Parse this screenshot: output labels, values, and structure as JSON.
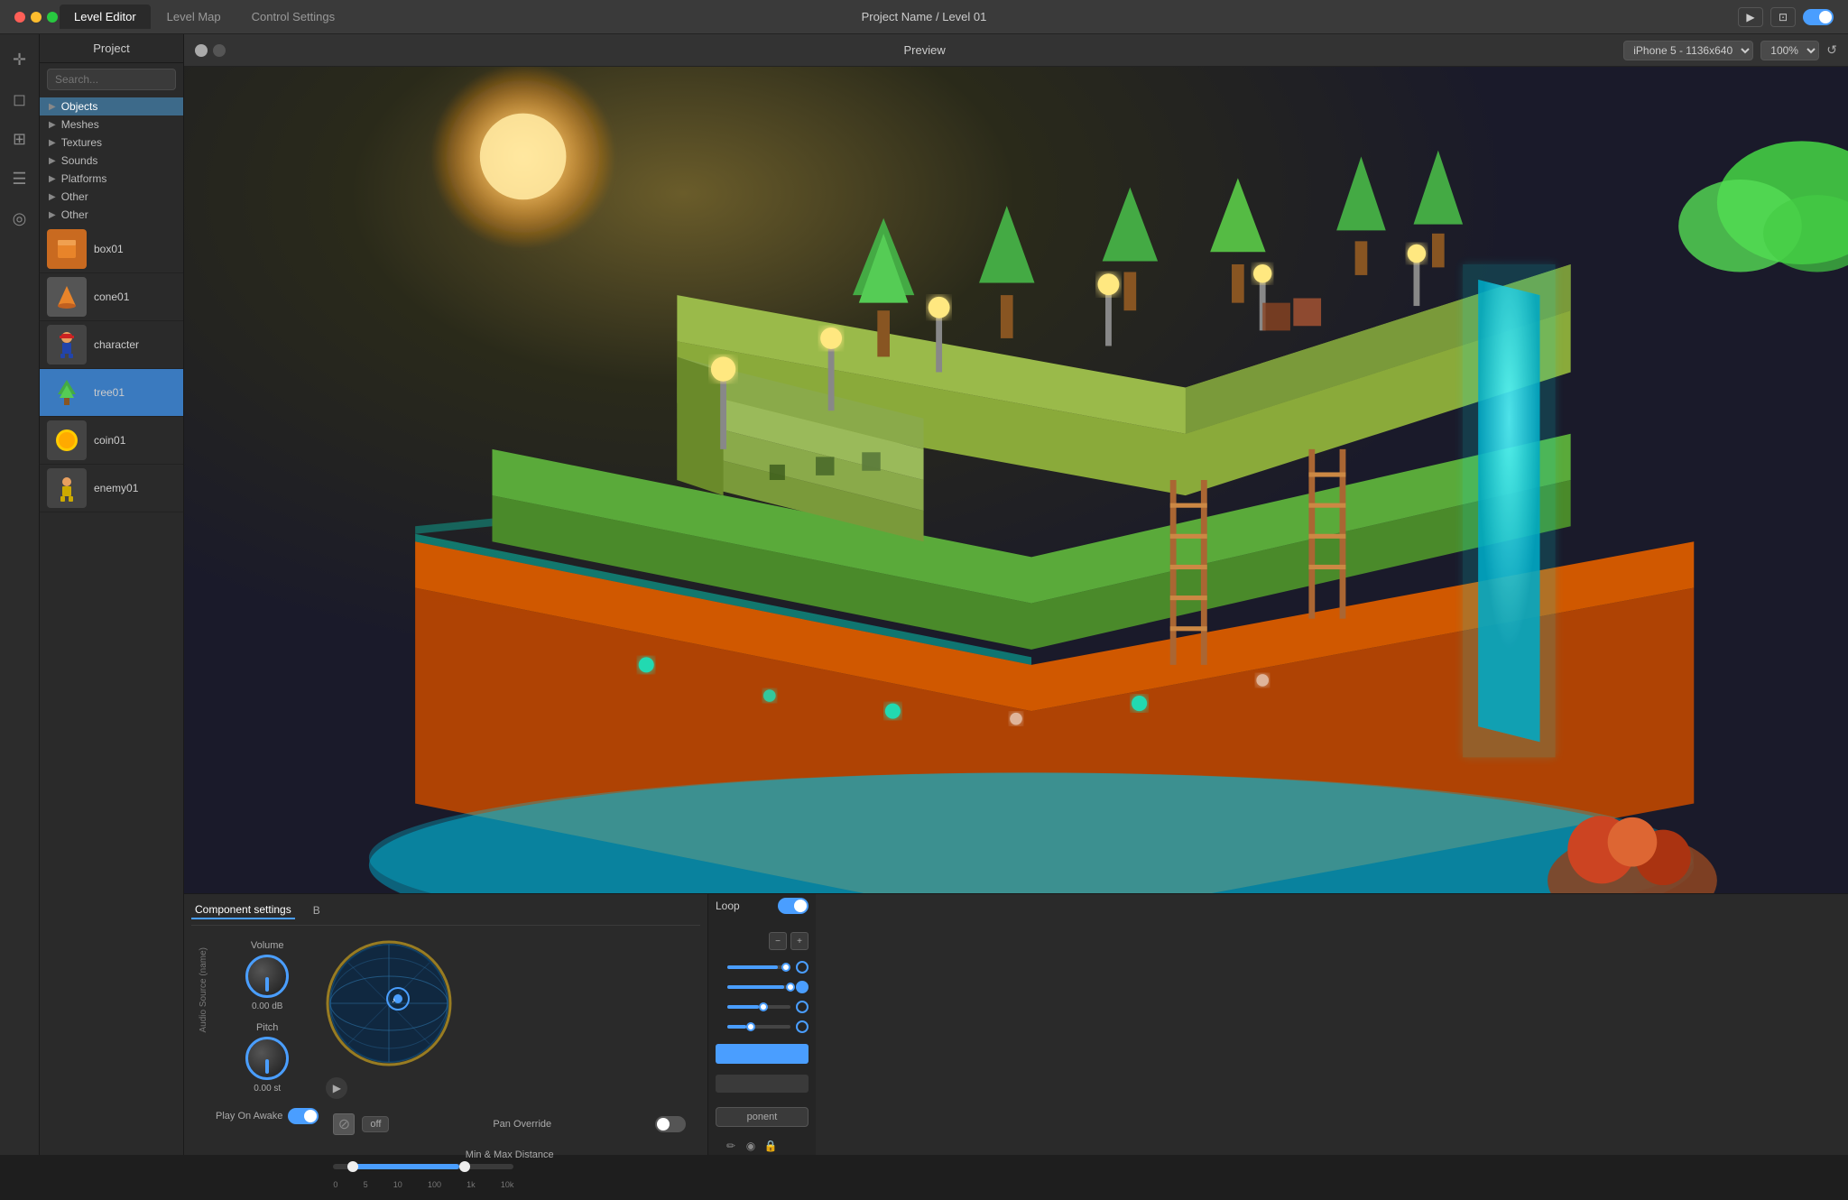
{
  "titlebar": {
    "title": "Project Name / Level 01",
    "tabs": [
      {
        "label": "Level Editor",
        "active": true
      },
      {
        "label": "Level Map",
        "active": false
      },
      {
        "label": "Control Settings",
        "active": false
      }
    ],
    "dots": [
      "red",
      "yellow",
      "green"
    ]
  },
  "iconbar": {
    "items": [
      {
        "name": "cursor-icon",
        "symbol": "⊹",
        "active": true
      },
      {
        "name": "grid-icon",
        "symbol": "⊞"
      },
      {
        "name": "cube-icon",
        "symbol": "◻"
      },
      {
        "name": "layers-icon",
        "symbol": "⊟"
      },
      {
        "name": "globe-icon",
        "symbol": "◎"
      }
    ]
  },
  "leftpanel": {
    "header": "Project",
    "search_placeholder": "Search...",
    "tree": [
      {
        "label": "Objects",
        "arrow": "▶",
        "selected": true
      },
      {
        "label": "Meshes",
        "arrow": "▶"
      },
      {
        "label": "Textures",
        "arrow": "▶"
      },
      {
        "label": "Sounds",
        "arrow": "▶"
      },
      {
        "label": "Platforms",
        "arrow": "▶"
      },
      {
        "label": "Other",
        "arrow": "▶"
      },
      {
        "label": "Other",
        "arrow": "▶"
      }
    ],
    "objects": [
      {
        "id": "box01",
        "label": "box01",
        "emoji": "🟧"
      },
      {
        "id": "cone01",
        "label": "cone01",
        "emoji": "🔶"
      },
      {
        "id": "character",
        "label": "character",
        "emoji": "🤸"
      },
      {
        "id": "tree01",
        "label": "tree01",
        "emoji": "🌳",
        "selected": true
      },
      {
        "id": "coin01",
        "label": "coin01",
        "emoji": "🟡"
      },
      {
        "id": "enemy01",
        "label": "enemy01",
        "emoji": "👕"
      }
    ]
  },
  "preview": {
    "title": "Preview",
    "device": "iPhone 5 - 1136x640",
    "zoom": "100%",
    "traffic_dots": [
      "red",
      "yellow",
      "green"
    ]
  },
  "component_settings": {
    "header": "Component settings",
    "tab2": "B",
    "volume_label": "Volume",
    "volume_value": "0.00 dB",
    "pitch_label": "Pitch",
    "pitch_value": "0.00 st",
    "play_on_awake_label": "Play On Awake",
    "pan_override_label": "Pan Override",
    "pan_off_label": "off",
    "min_max_distance_label": "Min & Max Distance",
    "distance_markers": [
      "0",
      "5",
      "10",
      "100",
      "1k",
      "10k"
    ]
  },
  "inspector": {
    "loop_label": "Loop",
    "component_btn_label": "ponent",
    "minus_label": "−",
    "plus_label": "+"
  }
}
